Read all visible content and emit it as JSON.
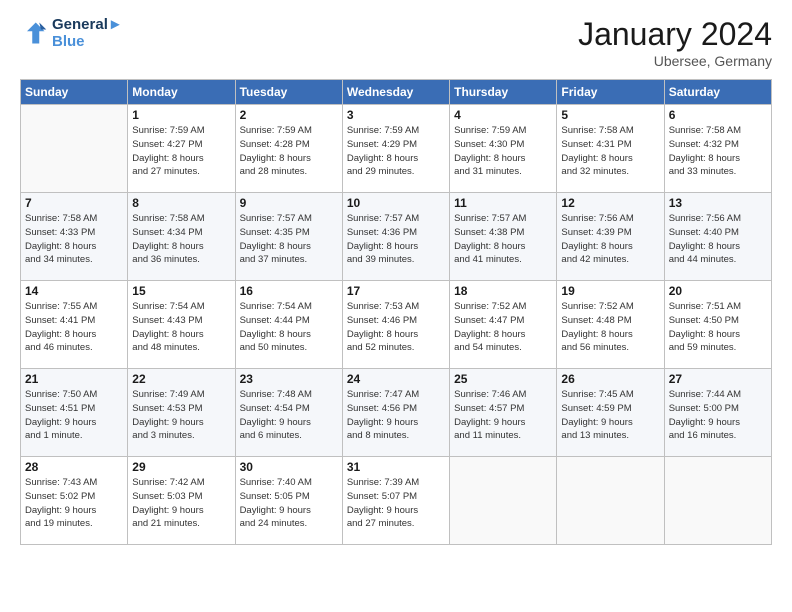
{
  "header": {
    "logo_line1": "General",
    "logo_line2": "Blue",
    "month": "January 2024",
    "location": "Ubersee, Germany"
  },
  "weekdays": [
    "Sunday",
    "Monday",
    "Tuesday",
    "Wednesday",
    "Thursday",
    "Friday",
    "Saturday"
  ],
  "weeks": [
    [
      {
        "day": "",
        "info": ""
      },
      {
        "day": "1",
        "info": "Sunrise: 7:59 AM\nSunset: 4:27 PM\nDaylight: 8 hours\nand 27 minutes."
      },
      {
        "day": "2",
        "info": "Sunrise: 7:59 AM\nSunset: 4:28 PM\nDaylight: 8 hours\nand 28 minutes."
      },
      {
        "day": "3",
        "info": "Sunrise: 7:59 AM\nSunset: 4:29 PM\nDaylight: 8 hours\nand 29 minutes."
      },
      {
        "day": "4",
        "info": "Sunrise: 7:59 AM\nSunset: 4:30 PM\nDaylight: 8 hours\nand 31 minutes."
      },
      {
        "day": "5",
        "info": "Sunrise: 7:58 AM\nSunset: 4:31 PM\nDaylight: 8 hours\nand 32 minutes."
      },
      {
        "day": "6",
        "info": "Sunrise: 7:58 AM\nSunset: 4:32 PM\nDaylight: 8 hours\nand 33 minutes."
      }
    ],
    [
      {
        "day": "7",
        "info": "Sunrise: 7:58 AM\nSunset: 4:33 PM\nDaylight: 8 hours\nand 34 minutes."
      },
      {
        "day": "8",
        "info": "Sunrise: 7:58 AM\nSunset: 4:34 PM\nDaylight: 8 hours\nand 36 minutes."
      },
      {
        "day": "9",
        "info": "Sunrise: 7:57 AM\nSunset: 4:35 PM\nDaylight: 8 hours\nand 37 minutes."
      },
      {
        "day": "10",
        "info": "Sunrise: 7:57 AM\nSunset: 4:36 PM\nDaylight: 8 hours\nand 39 minutes."
      },
      {
        "day": "11",
        "info": "Sunrise: 7:57 AM\nSunset: 4:38 PM\nDaylight: 8 hours\nand 41 minutes."
      },
      {
        "day": "12",
        "info": "Sunrise: 7:56 AM\nSunset: 4:39 PM\nDaylight: 8 hours\nand 42 minutes."
      },
      {
        "day": "13",
        "info": "Sunrise: 7:56 AM\nSunset: 4:40 PM\nDaylight: 8 hours\nand 44 minutes."
      }
    ],
    [
      {
        "day": "14",
        "info": "Sunrise: 7:55 AM\nSunset: 4:41 PM\nDaylight: 8 hours\nand 46 minutes."
      },
      {
        "day": "15",
        "info": "Sunrise: 7:54 AM\nSunset: 4:43 PM\nDaylight: 8 hours\nand 48 minutes."
      },
      {
        "day": "16",
        "info": "Sunrise: 7:54 AM\nSunset: 4:44 PM\nDaylight: 8 hours\nand 50 minutes."
      },
      {
        "day": "17",
        "info": "Sunrise: 7:53 AM\nSunset: 4:46 PM\nDaylight: 8 hours\nand 52 minutes."
      },
      {
        "day": "18",
        "info": "Sunrise: 7:52 AM\nSunset: 4:47 PM\nDaylight: 8 hours\nand 54 minutes."
      },
      {
        "day": "19",
        "info": "Sunrise: 7:52 AM\nSunset: 4:48 PM\nDaylight: 8 hours\nand 56 minutes."
      },
      {
        "day": "20",
        "info": "Sunrise: 7:51 AM\nSunset: 4:50 PM\nDaylight: 8 hours\nand 59 minutes."
      }
    ],
    [
      {
        "day": "21",
        "info": "Sunrise: 7:50 AM\nSunset: 4:51 PM\nDaylight: 9 hours\nand 1 minute."
      },
      {
        "day": "22",
        "info": "Sunrise: 7:49 AM\nSunset: 4:53 PM\nDaylight: 9 hours\nand 3 minutes."
      },
      {
        "day": "23",
        "info": "Sunrise: 7:48 AM\nSunset: 4:54 PM\nDaylight: 9 hours\nand 6 minutes."
      },
      {
        "day": "24",
        "info": "Sunrise: 7:47 AM\nSunset: 4:56 PM\nDaylight: 9 hours\nand 8 minutes."
      },
      {
        "day": "25",
        "info": "Sunrise: 7:46 AM\nSunset: 4:57 PM\nDaylight: 9 hours\nand 11 minutes."
      },
      {
        "day": "26",
        "info": "Sunrise: 7:45 AM\nSunset: 4:59 PM\nDaylight: 9 hours\nand 13 minutes."
      },
      {
        "day": "27",
        "info": "Sunrise: 7:44 AM\nSunset: 5:00 PM\nDaylight: 9 hours\nand 16 minutes."
      }
    ],
    [
      {
        "day": "28",
        "info": "Sunrise: 7:43 AM\nSunset: 5:02 PM\nDaylight: 9 hours\nand 19 minutes."
      },
      {
        "day": "29",
        "info": "Sunrise: 7:42 AM\nSunset: 5:03 PM\nDaylight: 9 hours\nand 21 minutes."
      },
      {
        "day": "30",
        "info": "Sunrise: 7:40 AM\nSunset: 5:05 PM\nDaylight: 9 hours\nand 24 minutes."
      },
      {
        "day": "31",
        "info": "Sunrise: 7:39 AM\nSunset: 5:07 PM\nDaylight: 9 hours\nand 27 minutes."
      },
      {
        "day": "",
        "info": ""
      },
      {
        "day": "",
        "info": ""
      },
      {
        "day": "",
        "info": ""
      }
    ]
  ]
}
